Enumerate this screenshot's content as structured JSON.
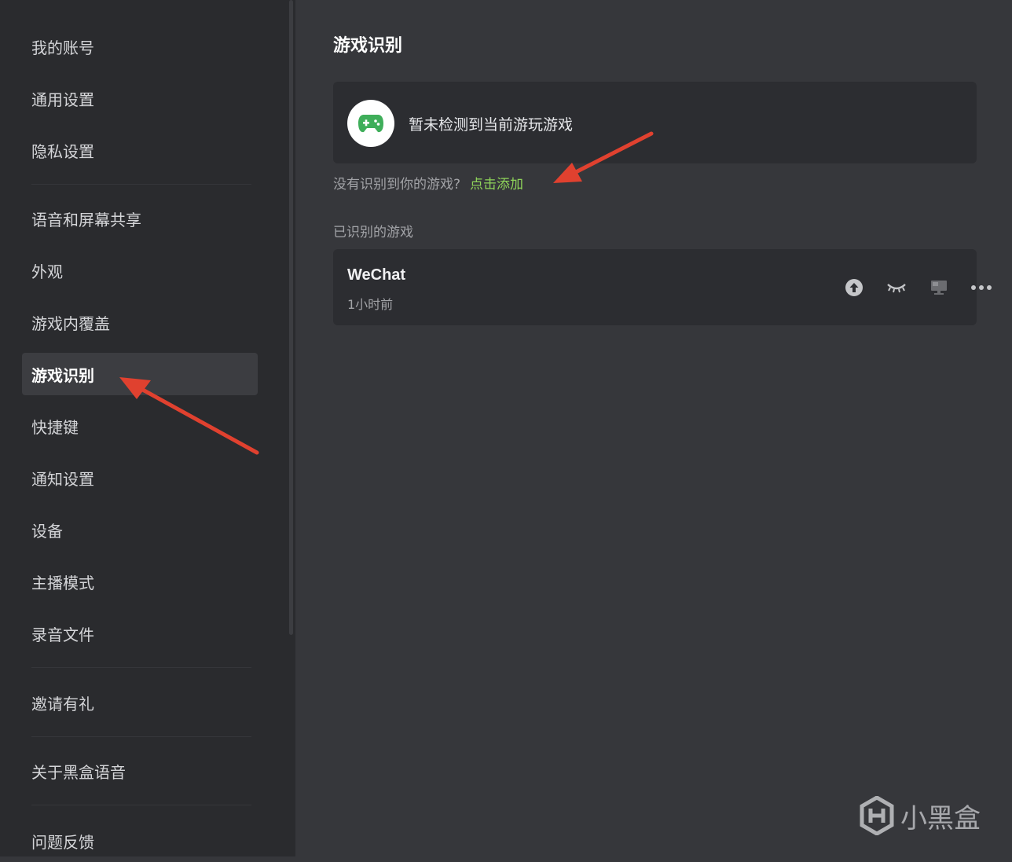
{
  "sidebar": {
    "items": [
      {
        "label": "我的账号"
      },
      {
        "label": "通用设置"
      },
      {
        "label": "隐私设置"
      },
      {
        "label": "语音和屏幕共享"
      },
      {
        "label": "外观"
      },
      {
        "label": "游戏内覆盖"
      },
      {
        "label": "游戏识别"
      },
      {
        "label": "快捷键"
      },
      {
        "label": "通知设置"
      },
      {
        "label": "设备"
      },
      {
        "label": "主播模式"
      },
      {
        "label": "录音文件"
      },
      {
        "label": "邀请有礼"
      },
      {
        "label": "关于黑盒语音"
      },
      {
        "label": "问题反馈"
      }
    ],
    "active_label": "游戏识别"
  },
  "main": {
    "title": "游戏识别",
    "detect_card": {
      "icon": "gamepad-icon",
      "text": "暂未检测到当前游玩游戏"
    },
    "hint": {
      "text": "没有识别到你的游戏?",
      "link": "点击添加"
    },
    "recognized_section_label": "已识别的游戏",
    "games": [
      {
        "name": "WeChat",
        "time": "1小时前",
        "actions": [
          "upload-icon",
          "eye-closed-icon",
          "monitor-icon",
          "more-icon"
        ]
      }
    ]
  },
  "watermark": {
    "text": "小黑盒"
  },
  "colors": {
    "sidebar_bg": "#2a2b2e",
    "main_bg": "#36373b",
    "card_bg": "#2c2d31",
    "accent_green": "#8fd45a",
    "annotation_red": "#e0412f"
  }
}
